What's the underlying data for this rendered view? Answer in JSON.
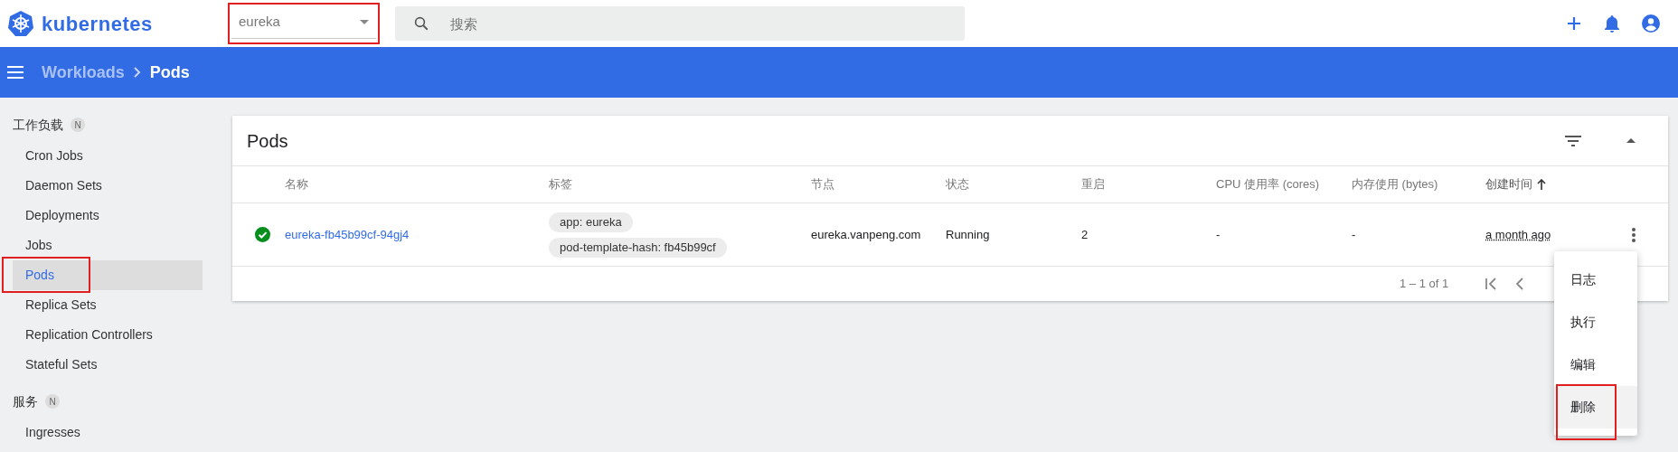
{
  "header": {
    "logo": "kubernetes",
    "namespace": {
      "value": "eureka",
      "annotated": true
    },
    "search": {
      "placeholder": "搜索"
    }
  },
  "breadcrumb": [
    {
      "label": "Workloads",
      "current": false
    },
    {
      "label": "Pods",
      "current": true
    }
  ],
  "sidebar": {
    "sections": [
      {
        "title": "工作负载",
        "badge": "N",
        "items": [
          {
            "label": "Cron Jobs",
            "selected": false,
            "annotated": false
          },
          {
            "label": "Daemon Sets",
            "selected": false,
            "annotated": false
          },
          {
            "label": "Deployments",
            "selected": false,
            "annotated": false
          },
          {
            "label": "Jobs",
            "selected": false,
            "annotated": false
          },
          {
            "label": "Pods",
            "selected": true,
            "annotated": true
          },
          {
            "label": "Replica Sets",
            "selected": false,
            "annotated": false
          },
          {
            "label": "Replication Controllers",
            "selected": false,
            "annotated": false
          },
          {
            "label": "Stateful Sets",
            "selected": false,
            "annotated": false
          }
        ]
      },
      {
        "title": "服务",
        "badge": "N",
        "items": [
          {
            "label": "Ingresses",
            "selected": false,
            "annotated": false
          }
        ]
      }
    ]
  },
  "card": {
    "title": "Pods",
    "columns": [
      {
        "label": "名称",
        "sorted": false
      },
      {
        "label": "标签",
        "sorted": false
      },
      {
        "label": "节点",
        "sorted": false
      },
      {
        "label": "状态",
        "sorted": false
      },
      {
        "label": "重启",
        "sorted": false
      },
      {
        "label": "CPU 使用率 (cores)",
        "sorted": false
      },
      {
        "label": "内存使用 (bytes)",
        "sorted": false
      },
      {
        "label": "创建时间",
        "sorted": true
      }
    ],
    "rows": [
      {
        "running": true,
        "name": "eureka-fb45b99cf-94gj4",
        "labels": [
          "app: eureka",
          "pod-template-hash: fb45b99cf"
        ],
        "node": "eureka.vanpeng.com",
        "state": "Running",
        "restarts": "2",
        "cpu": "-",
        "memory": "-",
        "created": "a month ago"
      }
    ],
    "pagination": "1 – 1 of 1"
  },
  "context_menu": [
    {
      "label": "日志",
      "selected": false,
      "annotated": false
    },
    {
      "label": "执行",
      "selected": false,
      "annotated": false
    },
    {
      "label": "编辑",
      "selected": false,
      "annotated": false
    },
    {
      "label": "删除",
      "selected": true,
      "annotated": true
    }
  ]
}
